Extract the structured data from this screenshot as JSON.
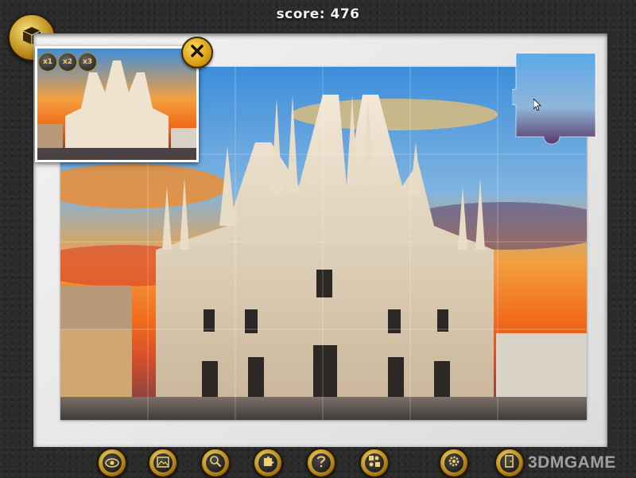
{
  "score": {
    "text": "score: 476"
  },
  "preview": {
    "zoom_labels": [
      "x1",
      "x2",
      "x3"
    ]
  },
  "toolbar": {
    "buttons": [
      "eye-icon",
      "picture-icon",
      "magnifier-icon",
      "puzzle-piece-icon",
      "question-icon",
      "puzzle-sort-icon",
      "gear-icon",
      "exit-door-icon"
    ]
  },
  "watermark": {
    "text": "3DMGAME"
  },
  "colors": {
    "gold": "#d8a323",
    "sky_blue": "#4f9de0",
    "sunset_orange": "#f07d1e",
    "cathedral_stone": "#efe3cf"
  }
}
